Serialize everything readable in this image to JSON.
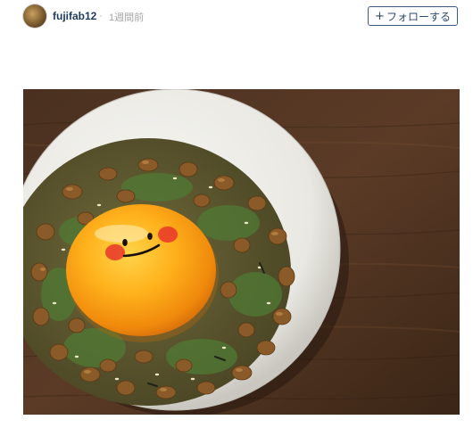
{
  "post_header": {
    "username": "fujifab12",
    "separator": "·",
    "time_ago": "1週間前",
    "follow_label": "フォローする",
    "follow_icon": "plus-icon"
  },
  "photo": {
    "subject_icon": "natto-rice-bowl-with-egg-yolk-face"
  }
}
